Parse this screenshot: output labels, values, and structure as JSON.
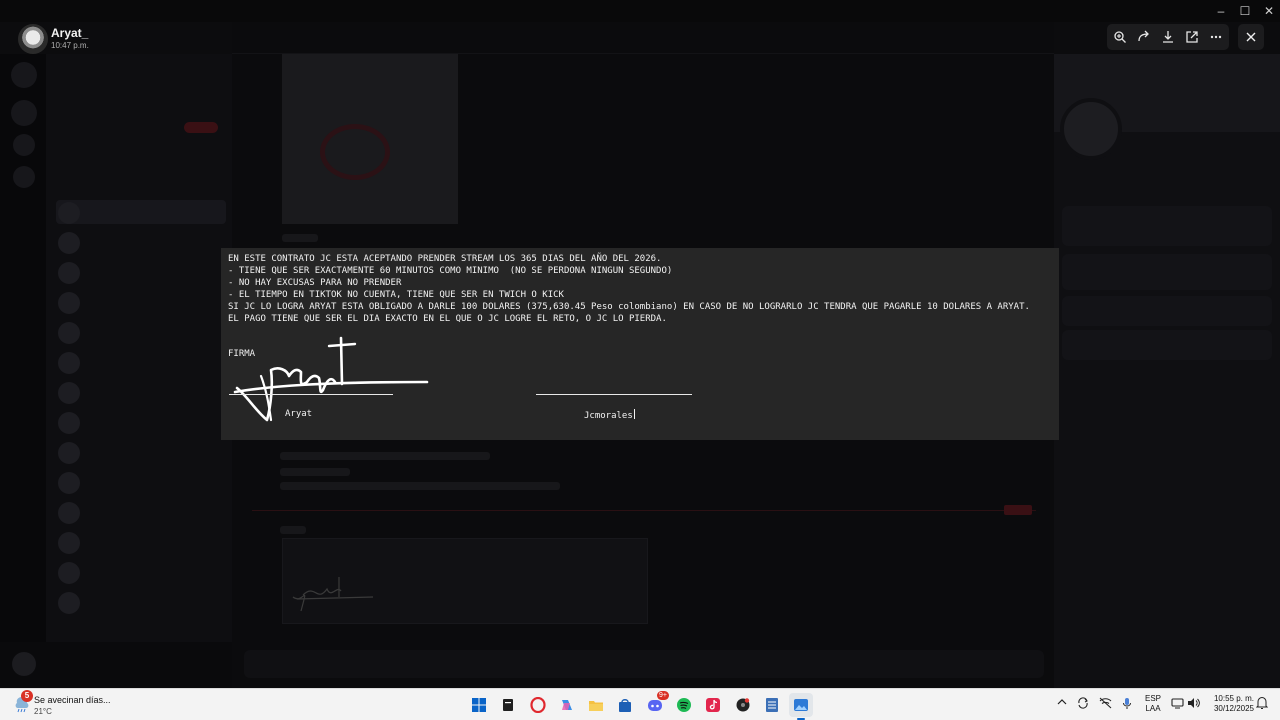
{
  "viewer": {
    "user_name": "Aryat_",
    "timestamp": "10:47 p.m."
  },
  "toolbar": {
    "icons": [
      "zoom-in-icon",
      "forward-icon",
      "download-icon",
      "open-external-icon",
      "more-icon"
    ],
    "close_icon": "close-icon"
  },
  "document": {
    "lines": [
      "EN ESTE CONTRATO JC ESTA ACEPTANDO PRENDER STREAM LOS 365 DIAS DEL AÑO DEL 2026.",
      "- TIENE QUE SER EXACTAMENTE 60 MINUTOS COMO MINIMO  (NO SE PERDONA NINGUN SEGUNDO)",
      "- NO HAY EXCUSAS PARA NO PRENDER",
      "- EL TIEMPO EN TIKTOK NO CUENTA, TIENE QUE SER EN TWICH O KICK",
      "SI JC LO LOGRA ARYAT ESTA OBLIGADO A DARLE 100 DOLARES (375,630.45 Peso colombiano) EN CASO DE NO LOGRARLO JC TENDRA QUE PAGARLE 10 DOLARES A ARYAT.",
      "EL PAGO TIENE QUE SER EL DIA EXACTO EN EL QUE O JC LOGRE EL RETO, O JC LO PIERDA."
    ],
    "firma_label": "FIRMA",
    "signer_left": "Aryat",
    "signer_right": "Jcmorales"
  },
  "taskbar": {
    "weather_alert_count": "5",
    "weather_text": "Se avecinan días...",
    "weather_temp": "21°C",
    "pinned_apps": [
      "start-icon",
      "file-icon",
      "opera-icon",
      "copilot-icon",
      "folder-icon",
      "store-icon",
      "discord-icon",
      "spotify-icon",
      "tiktok-icon",
      "app-icon",
      "notepad-icon",
      "image-viewer-icon"
    ],
    "discord_badge": "9+",
    "tray_icons": [
      "chevron-up-icon",
      "sync-icon",
      "network-off-icon",
      "microphone-icon",
      "volume-icon"
    ],
    "language": "ESP",
    "keyboard": "LAA",
    "time": "10:55 p. m.",
    "date": "30/12/2025"
  },
  "colors": {
    "overlay": "#000000",
    "document_bg": "#262626",
    "document_text": "#f2f2f2",
    "taskbar_bg": "#f3f3f3",
    "accent": "#0a64c8"
  }
}
